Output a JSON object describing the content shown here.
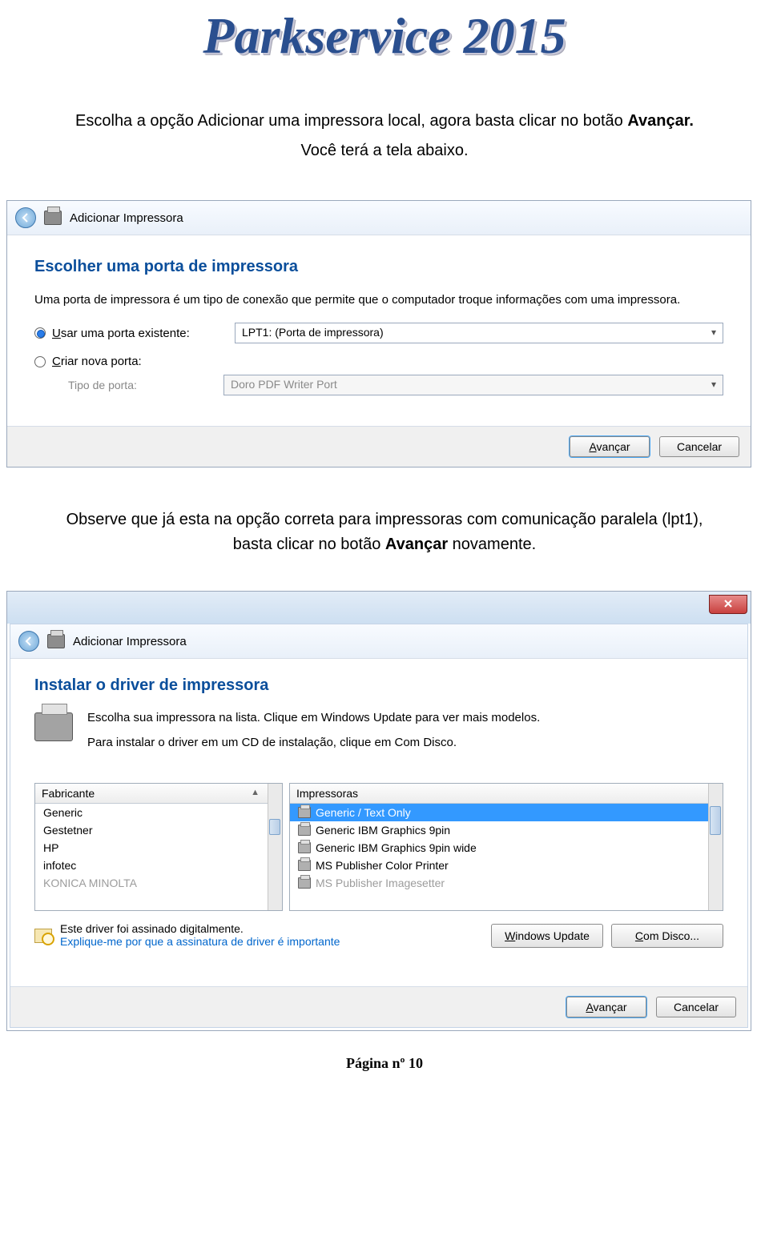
{
  "title": "Parkservice 2015",
  "intro1a": "Escolha a opção Adicionar uma impressora local, agora basta clicar no botão ",
  "intro1b": "Avançar.",
  "intro2": "Você terá a tela abaixo.",
  "dialog1": {
    "header": "Adicionar Impressora",
    "section": "Escolher uma porta de impressora",
    "desc": "Uma porta de impressora é um tipo de conexão que permite que o computador troque informações com uma impressora.",
    "radio1": "Usar uma porta existente:",
    "dropdown1": "LPT1: (Porta de impressora)",
    "radio2": "Criar nova porta:",
    "typeLabel": "Tipo de porta:",
    "dropdown2": "Doro PDF Writer Port",
    "next": "Avançar",
    "cancel": "Cancelar"
  },
  "mid1a": "Observe que já esta na opção correta para impressoras com comunicação paralela (lpt1),",
  "mid2a": "basta clicar no botão ",
  "mid2b": "Avançar",
  "mid2c": " novamente.",
  "dialog2": {
    "header": "Adicionar Impressora",
    "section": "Instalar o driver de impressora",
    "desc1": "Escolha sua impressora na lista. Clique em Windows Update para ver mais modelos.",
    "desc2": "Para instalar o driver em um CD de instalação, clique em Com Disco.",
    "col1": "Fabricante",
    "makers": [
      "Generic",
      "Gestetner",
      "HP",
      "infotec",
      "KONICA MINOLTA"
    ],
    "col2": "Impressoras",
    "printers": [
      "Generic / Text Only",
      "Generic IBM Graphics 9pin",
      "Generic IBM Graphics 9pin wide",
      "MS Publisher Color Printer",
      "MS Publisher Imagesetter"
    ],
    "signed": "Este driver foi assinado digitalmente.",
    "link": "Explique-me por que a assinatura de driver é importante",
    "winUpdate": "Windows Update",
    "disk": "Com Disco...",
    "next": "Avançar",
    "cancel": "Cancelar"
  },
  "footer": "Página nº 10"
}
